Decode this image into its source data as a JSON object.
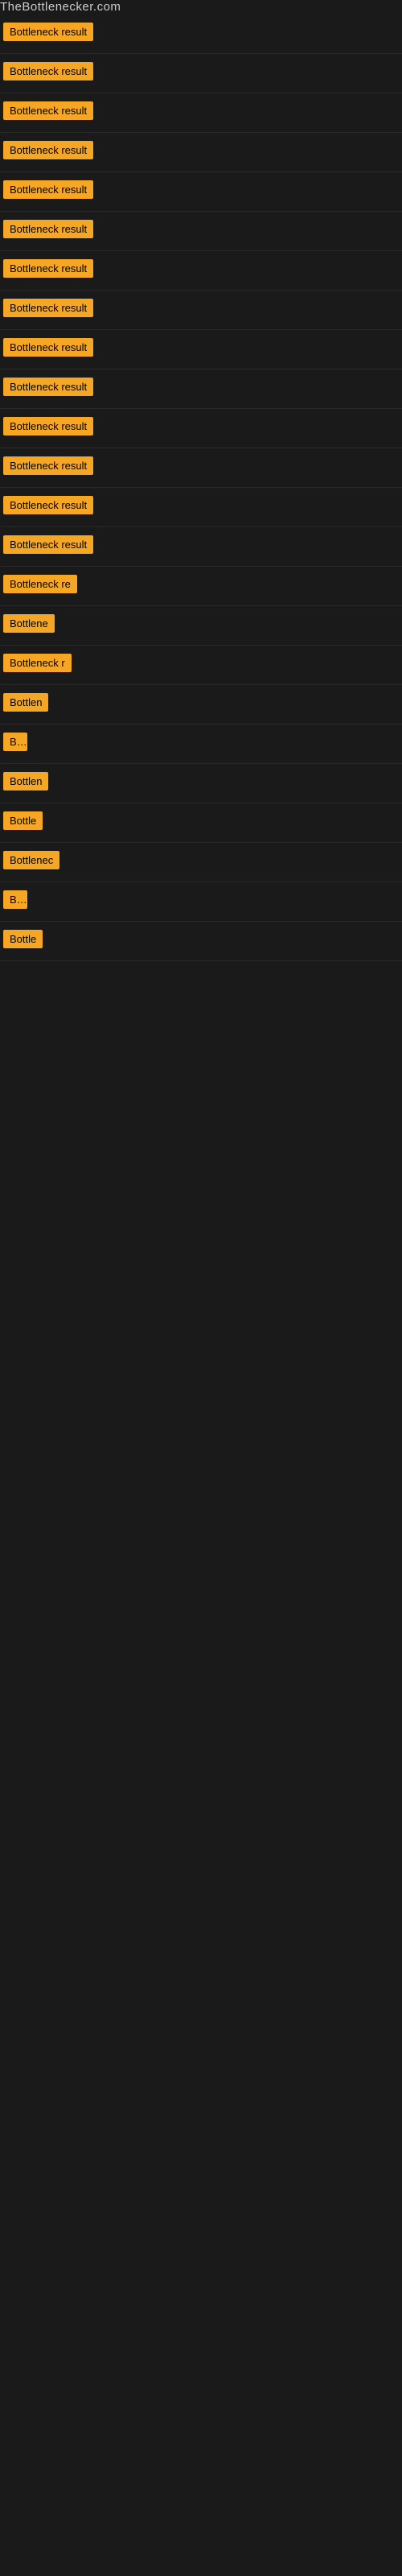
{
  "site": {
    "title": "TheBottlenecker.com"
  },
  "rows": [
    {
      "id": 1,
      "label": "Bottleneck result",
      "width": 120
    },
    {
      "id": 2,
      "label": "Bottleneck result",
      "width": 120
    },
    {
      "id": 3,
      "label": "Bottleneck result",
      "width": 120
    },
    {
      "id": 4,
      "label": "Bottleneck result",
      "width": 120
    },
    {
      "id": 5,
      "label": "Bottleneck result",
      "width": 120
    },
    {
      "id": 6,
      "label": "Bottleneck result",
      "width": 120
    },
    {
      "id": 7,
      "label": "Bottleneck result",
      "width": 120
    },
    {
      "id": 8,
      "label": "Bottleneck result",
      "width": 120
    },
    {
      "id": 9,
      "label": "Bottleneck result",
      "width": 120
    },
    {
      "id": 10,
      "label": "Bottleneck result",
      "width": 120
    },
    {
      "id": 11,
      "label": "Bottleneck result",
      "width": 120
    },
    {
      "id": 12,
      "label": "Bottleneck result",
      "width": 120
    },
    {
      "id": 13,
      "label": "Bottleneck result",
      "width": 120
    },
    {
      "id": 14,
      "label": "Bottleneck result",
      "width": 120
    },
    {
      "id": 15,
      "label": "Bottleneck re",
      "width": 100
    },
    {
      "id": 16,
      "label": "Bottlene",
      "width": 80
    },
    {
      "id": 17,
      "label": "Bottleneck r",
      "width": 90
    },
    {
      "id": 18,
      "label": "Bottlen",
      "width": 75
    },
    {
      "id": 19,
      "label": "Bo",
      "width": 30
    },
    {
      "id": 20,
      "label": "Bottlen",
      "width": 75
    },
    {
      "id": 21,
      "label": "Bottle",
      "width": 60
    },
    {
      "id": 22,
      "label": "Bottlenec",
      "width": 85
    },
    {
      "id": 23,
      "label": "Bo",
      "width": 30
    },
    {
      "id": 24,
      "label": "Bottle",
      "width": 60
    }
  ],
  "colors": {
    "tag_bg": "#f5a623",
    "tag_text": "#000000",
    "bg": "#1a1a1a",
    "header_text": "#cccccc"
  }
}
